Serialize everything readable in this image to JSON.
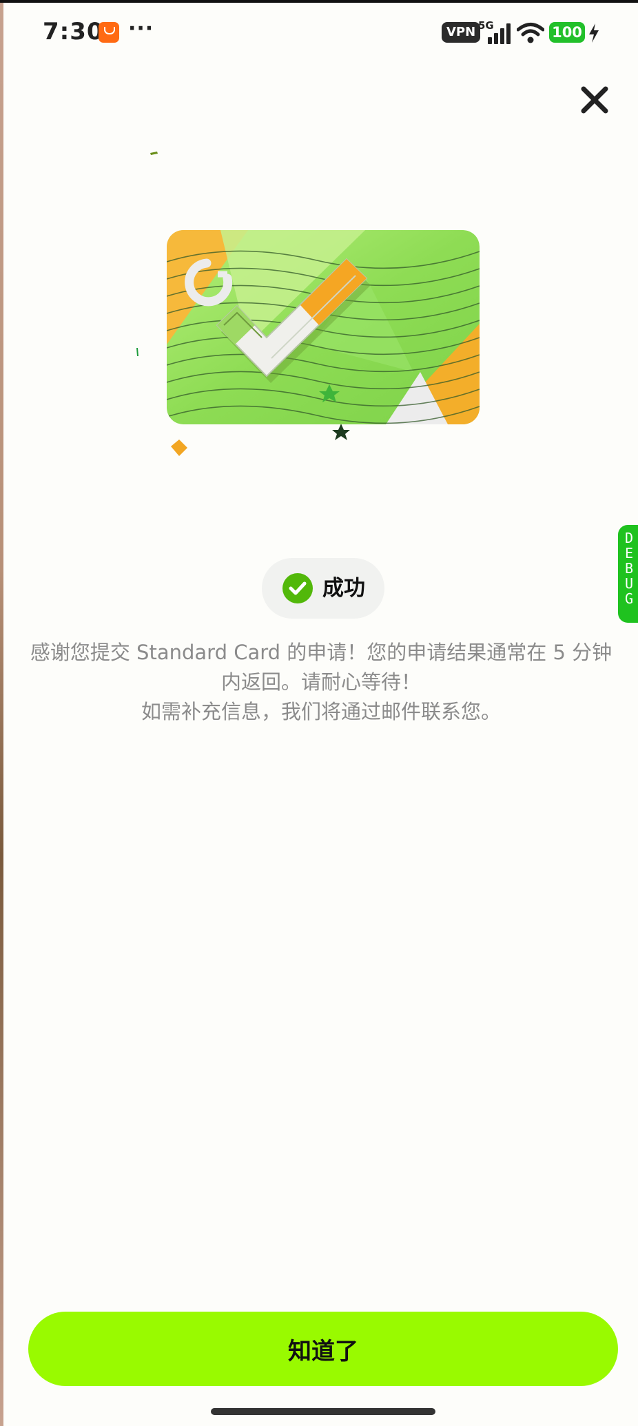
{
  "status_bar": {
    "time": "7:30",
    "more": "···",
    "vpn": "VPN",
    "network": "5G",
    "battery": "100"
  },
  "status": {
    "label": "成功"
  },
  "message": {
    "line1": "感谢您提交 Standard Card 的申请！您的申请结果通常在 5 分钟内返回。请耐心等待！",
    "line2": "如需补充信息，我们将通过邮件联系您。"
  },
  "debug_tab": {
    "letters": [
      "D",
      "E",
      "B",
      "U",
      "G"
    ]
  },
  "primary_button": {
    "label": "知道了"
  },
  "colors": {
    "accent": "#99fa00",
    "success": "#52b80a",
    "debug": "#1fc21f",
    "text_muted": "#8b8b8b"
  },
  "icons": {
    "close": "close-icon",
    "success": "check-circle-icon",
    "hero": "card-check-illustration"
  }
}
